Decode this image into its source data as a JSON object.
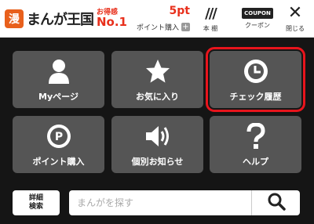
{
  "header": {
    "logo_mark": "漫",
    "logo_text": "まんが王国",
    "badge_small": "お得感",
    "badge_big": "No.1",
    "points_value": "5pt",
    "points_buy_label": "ポイント購入",
    "points_buy_icon": "+",
    "bookshelf_icon": "///",
    "bookshelf_label": "本 棚",
    "coupon_icon": "COUPON",
    "coupon_label": "クーポン",
    "close_icon": "✕",
    "close_label": "閉じる"
  },
  "menu": {
    "tiles": [
      {
        "label": "Myページ",
        "icon": "person-icon"
      },
      {
        "label": "お気に入り",
        "icon": "star-icon"
      },
      {
        "label": "チェック履歴",
        "icon": "clock-icon"
      },
      {
        "label": "ポイント購入",
        "icon": "point-coin-icon"
      },
      {
        "label": "個別お知らせ",
        "icon": "speaker-icon"
      },
      {
        "label": "ヘルプ",
        "icon": "question-icon"
      }
    ],
    "highlight_color": "#e8141c"
  },
  "search": {
    "detail_line1": "詳細",
    "detail_line2": "検索",
    "placeholder": "まんがを探す"
  }
}
